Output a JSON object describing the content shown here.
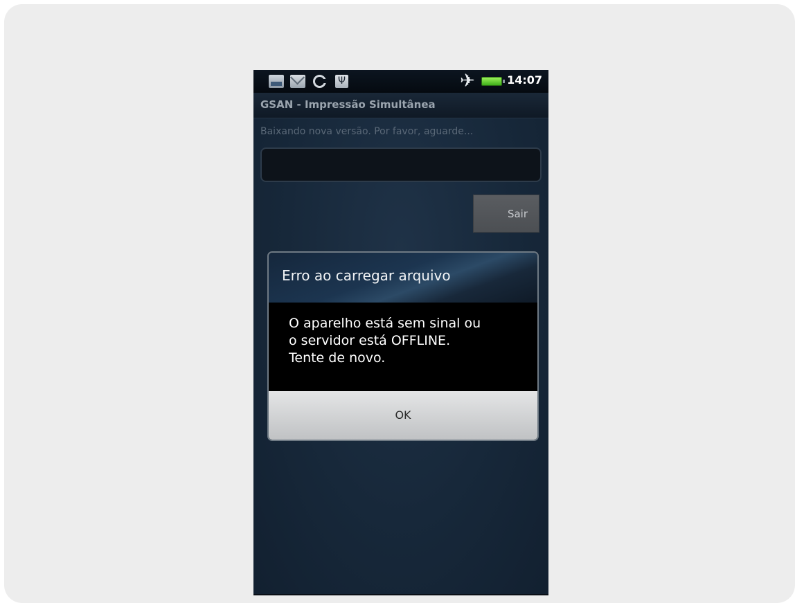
{
  "status_bar": {
    "icons": [
      "image-notification-icon",
      "mail-icon",
      "sync-icon",
      "usb-icon",
      "airplane-mode-icon",
      "battery-icon"
    ],
    "time": "14:07",
    "battery_color": "#3fb01b"
  },
  "app": {
    "title": "GSAN - Impressão Simultânea"
  },
  "main": {
    "download_message": "Baixando nova versão. Por favor, aguarde...",
    "exit_button_label": "Sair"
  },
  "dialog": {
    "title": "Erro ao carregar arquivo",
    "message_lines": [
      "O aparelho está sem sinal ou",
      "o servidor está OFFLINE.",
      "Tente de novo."
    ],
    "ok_button_label": "OK"
  },
  "colors": {
    "page_background": "#ededed",
    "screen_background": "#17283a",
    "dialog_body": "#000000",
    "dialog_footer": "#d4d5d6"
  }
}
